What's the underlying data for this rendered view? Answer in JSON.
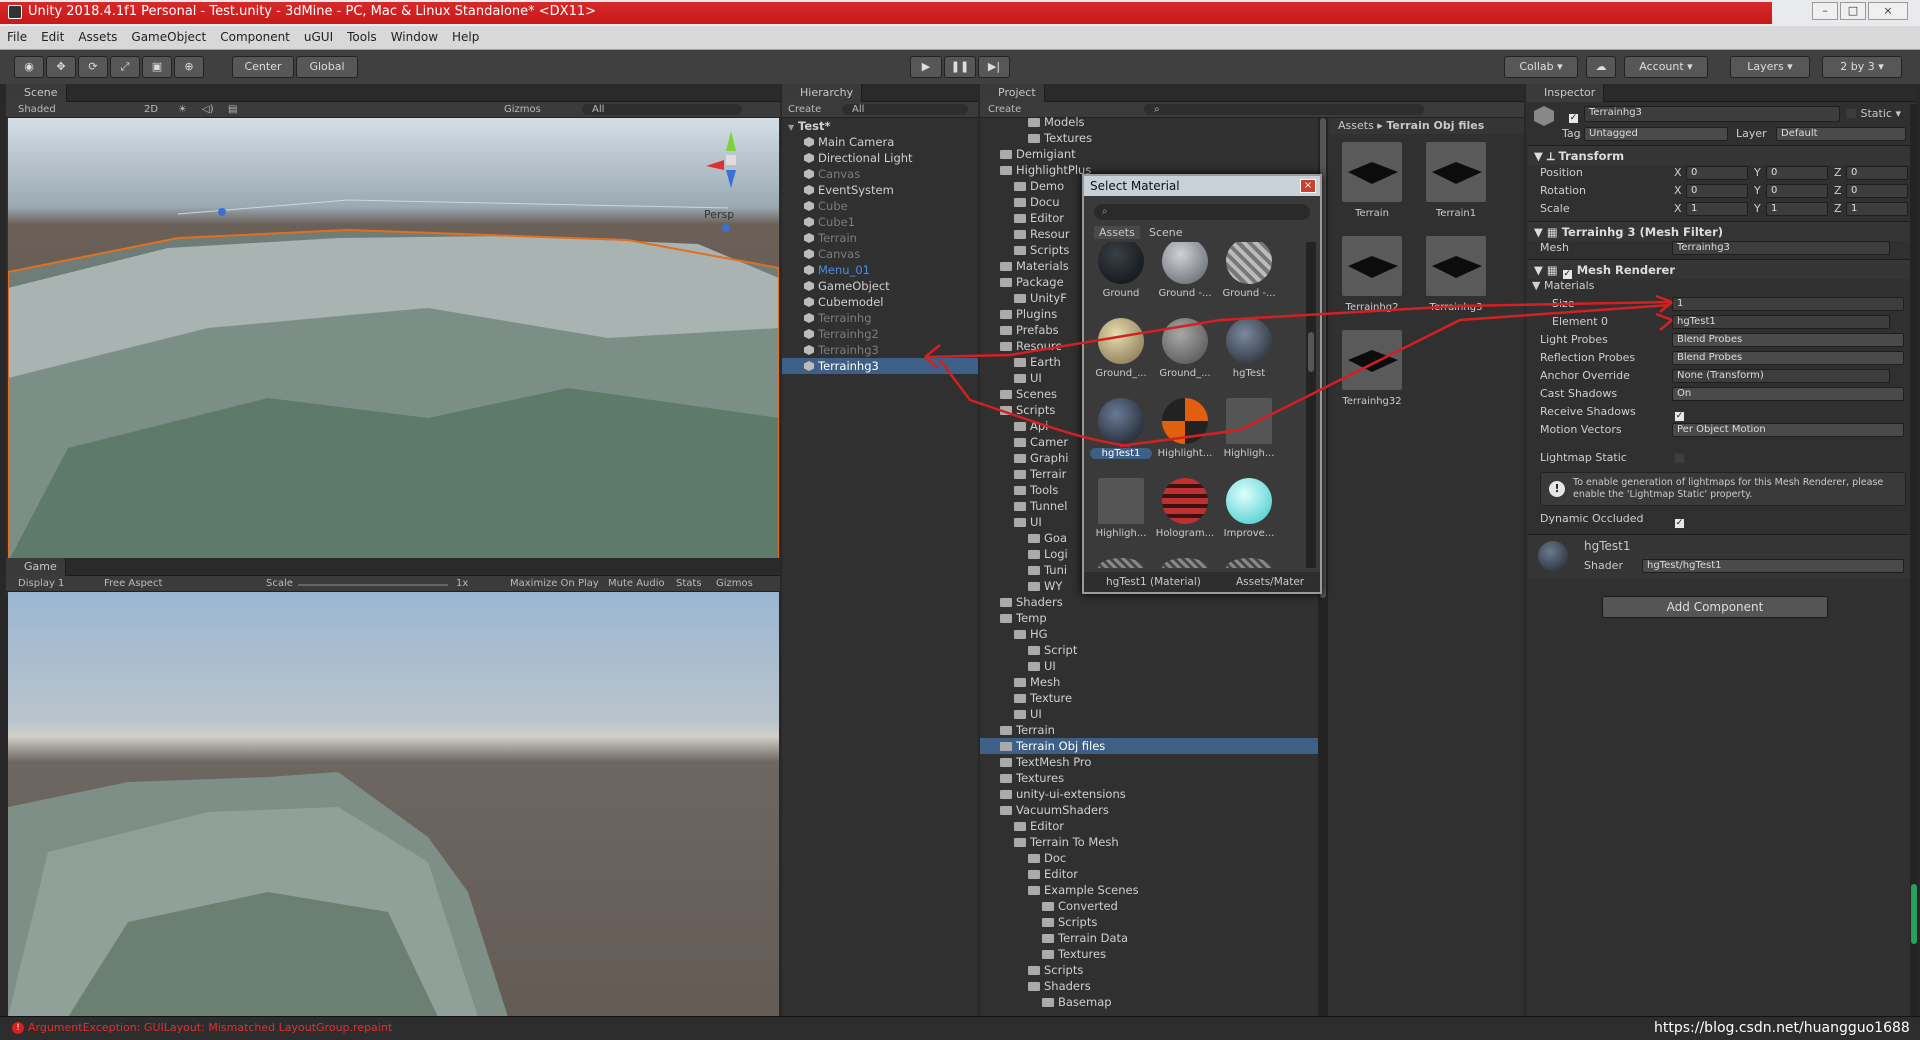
{
  "window": {
    "title": "Unity 2018.4.1f1 Personal - Test.unity - 3dMine - PC, Mac & Linux Standalone* <DX11>"
  },
  "menu": [
    "File",
    "Edit",
    "Assets",
    "GameObject",
    "Component",
    "uGUI",
    "Tools",
    "Window",
    "Help"
  ],
  "toolbar": {
    "center": "Center",
    "global": "Global",
    "collab": "Collab",
    "account": "Account",
    "layers": "Layers",
    "layout": "2 by 3"
  },
  "scene": {
    "tab": "Scene",
    "shading": "Shaded",
    "mode2d": "2D",
    "gizmos": "Gizmos",
    "search": "All",
    "persp": "Persp"
  },
  "game": {
    "tab": "Game",
    "display": "Display 1",
    "aspect": "Free Aspect",
    "scale_label": "Scale",
    "scale_value": "1x",
    "maximize": "Maximize On Play",
    "mute": "Mute Audio",
    "stats": "Stats",
    "gizmos": "Gizmos"
  },
  "hierarchy": {
    "tab": "Hierarchy",
    "create": "Create",
    "search": "All",
    "scene": "Test*",
    "items": [
      "Main Camera",
      "Directional Light",
      "Canvas",
      "EventSystem",
      "Cube",
      "Cube1",
      "Terrain",
      "Canvas",
      "Menu_01",
      "GameObject",
      "Cubemodel",
      "Terrainhg",
      "Terrainhg2",
      "Terrainhg3",
      "Terrainhg3"
    ]
  },
  "project": {
    "tab": "Project",
    "create": "Create",
    "tree": [
      "Models",
      "Textures",
      "Demigiant",
      "HighlightPlus",
      "Demo",
      "Docu",
      "Editor",
      "Resour",
      "Scripts",
      "Materials",
      "Package",
      "UnityF",
      "Plugins",
      "Prefabs",
      "Resourc",
      "Earth",
      "UI",
      "Scenes",
      "Scripts",
      "Api",
      "Camer",
      "Graphi",
      "Terrair",
      "Tools",
      "Tunnel",
      "UI",
      "Goa",
      "Logi",
      "Tuni",
      "WY",
      "Shaders",
      "Temp",
      "HG",
      "Script",
      "UI",
      "Mesh",
      "Texture",
      "UI",
      "Terrain",
      "Terrain Obj files",
      "TextMesh Pro",
      "Textures",
      "unity-ui-extensions",
      "VacuumShaders",
      "Editor",
      "Terrain To Mesh",
      "Doc",
      "Editor",
      "Example Scenes",
      "Converted",
      "Scripts",
      "Terrain Data",
      "Textures",
      "Scripts",
      "Shaders",
      "Basemap"
    ],
    "breadcrumb_root": "Assets",
    "breadcrumb_current": "Terrain Obj files",
    "assets": [
      "Terrain",
      "Terrain1",
      "Terrainhg2",
      "Terrainhg3",
      "Terrainhg32"
    ]
  },
  "select_material": {
    "title": "Select Material",
    "tab_assets": "Assets",
    "tab_scene": "Scene",
    "items": [
      "Ground",
      "Ground -...",
      "Ground -...",
      "Ground_...",
      "Ground_...",
      "hgTest",
      "hgTest1",
      "Highlight...",
      "Highligh...",
      "Highligh...",
      "Hologram...",
      "Improve..."
    ],
    "footer_left": "hgTest1 (Material)",
    "footer_right": "Assets/Mater"
  },
  "inspector": {
    "tab": "Inspector",
    "name": "Terrainhg3",
    "static": "Static",
    "tag_label": "Tag",
    "tag": "Untagged",
    "layer_label": "Layer",
    "layer": "Default",
    "transform": {
      "title": "Transform",
      "position": "Position",
      "rotation": "Rotation",
      "scale": "Scale",
      "x": "X",
      "y": "Y",
      "z": "Z",
      "pos": [
        "0",
        "0",
        "0"
      ],
      "rot": [
        "0",
        "0",
        "0"
      ],
      "scl": [
        "1",
        "1",
        "1"
      ]
    },
    "mesh_filter": {
      "title": "Terrainhg 3 (Mesh Filter)",
      "mesh_label": "Mesh",
      "mesh": "Terrainhg3"
    },
    "mesh_renderer": {
      "title": "Mesh Renderer",
      "materials": "Materials",
      "size_label": "Size",
      "size": "1",
      "element_label": "Element 0",
      "element": "hgTest1",
      "light_probes_label": "Light Probes",
      "light_probes": "Blend Probes",
      "reflection_label": "Reflection Probes",
      "reflection": "Blend Probes",
      "anchor_label": "Anchor Override",
      "anchor": "None (Transform)",
      "cast_label": "Cast Shadows",
      "cast": "On",
      "receive_label": "Receive Shadows",
      "motion_label": "Motion Vectors",
      "motion": "Per Object Motion",
      "lightmap_label": "Lightmap Static",
      "info": "To enable generation of lightmaps for this Mesh Renderer, please enable the 'Lightmap Static' property.",
      "occluded_label": "Dynamic Occluded"
    },
    "material": {
      "name": "hgTest1",
      "shader_label": "Shader",
      "shader": "hgTest/hgTest1"
    },
    "add_component": "Add Component"
  },
  "status": {
    "error": "ArgumentException: GUILayout: Mismatched LayoutGroup.repaint",
    "watermark": "https://blog.csdn.net/huangguo1688"
  },
  "colors": {
    "title_red": "#c81818",
    "selection": "#3e5f86",
    "annotation": "#d42020"
  }
}
